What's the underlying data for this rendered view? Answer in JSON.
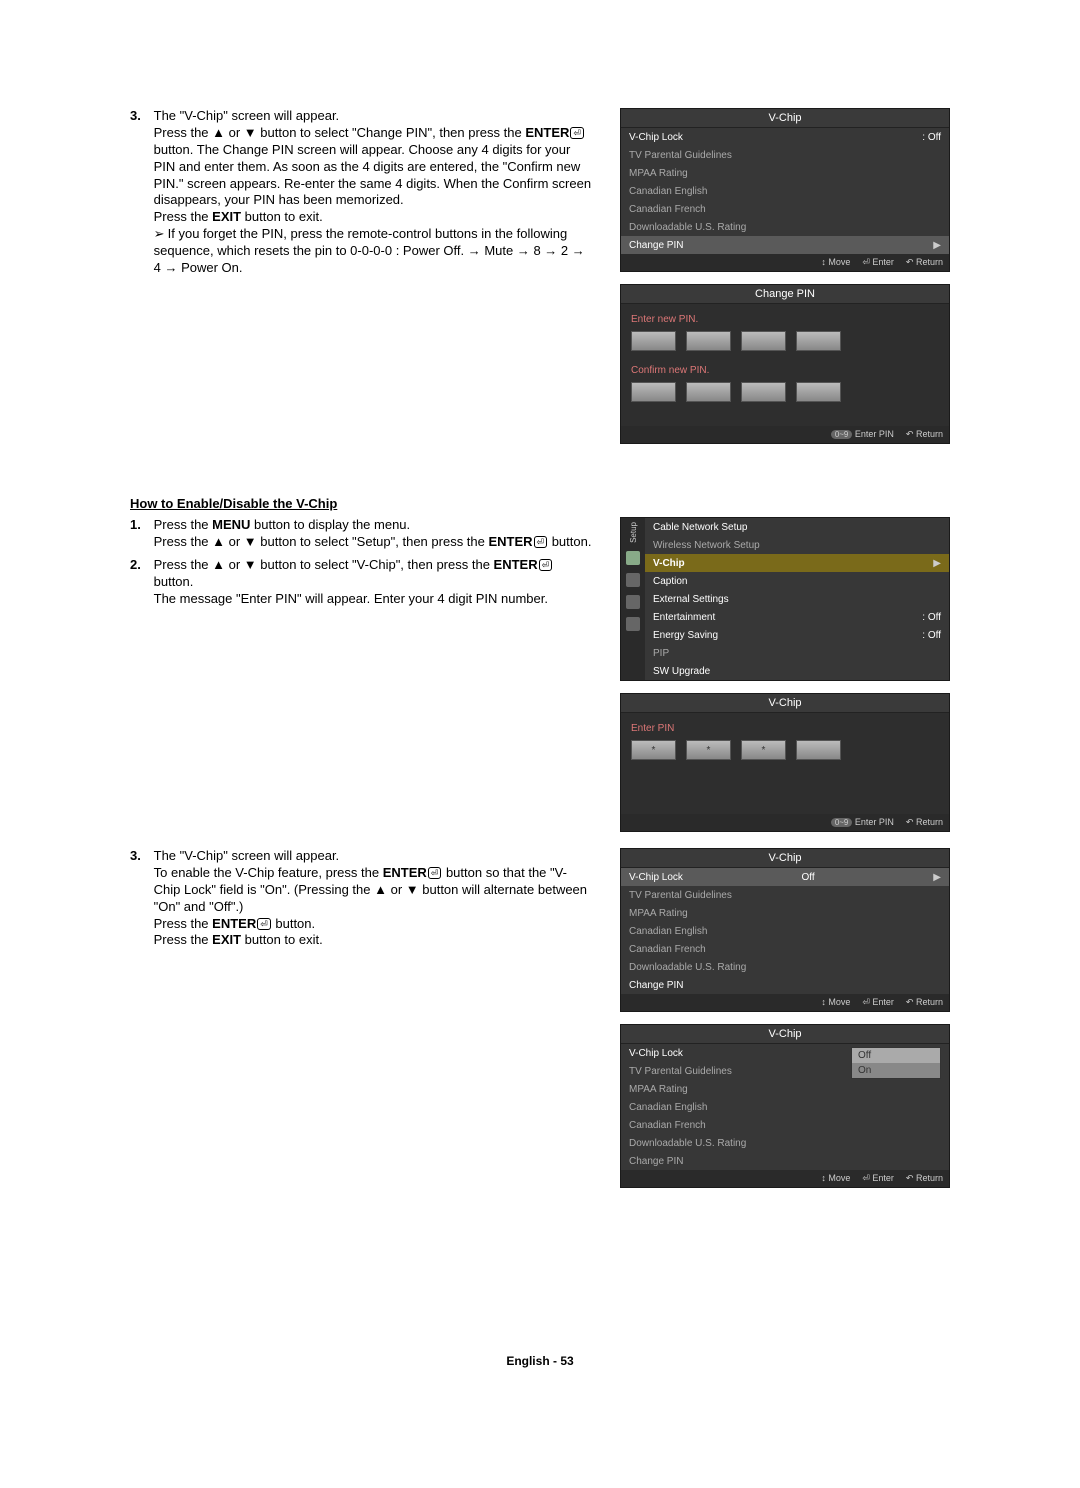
{
  "s1": {
    "num": "3.",
    "p1": "The \"V-Chip\" screen will appear.",
    "p2a": "Press the ▲ or ▼ button to select \"Change PIN\", then press the ",
    "p2b": "ENTER",
    "p2c": " button. The Change PIN screen will appear. Choose any 4 digits for your PIN and enter them. As soon as the 4 digits are entered, the \"Confirm new PIN.\" screen appears. Re-enter the same 4 digits. When the Confirm screen disappears, your PIN has been memorized.",
    "p3a": "Press the ",
    "p3b": "EXIT",
    "p3c": " button to exit.",
    "notemark": "➢",
    "note": "If you forget the PIN, press the remote-control buttons in the following sequence, which resets the pin to 0-0-0-0 : Power Off. → Mute → 8 → 2 → 4 → Power On."
  },
  "head2": "How to Enable/Disable the V-Chip",
  "s2a": {
    "num": "1.",
    "p1a": "Press the ",
    "p1b": "MENU",
    "p1c": " button to display the menu.",
    "p2a": "Press the ▲ or ▼ button to select \"Setup\", then press the ",
    "p2b": "ENTER",
    "p2c": " button."
  },
  "s2b": {
    "num": "2.",
    "p1a": "Press the ▲ or ▼ button to select \"V-Chip\", then press the ",
    "p1b": "ENTER",
    "p1c": " button.",
    "p2": "The message \"Enter PIN\" will appear. Enter your 4 digit PIN number."
  },
  "s3": {
    "num": "3.",
    "p1": "The \"V-Chip\" screen will appear.",
    "p2a": "To enable the V-Chip feature, press the ",
    "p2b": "ENTER",
    "p2c": " button so that the \"V-Chip Lock\" field is \"On\". (Pressing the ▲ or ▼ button will alternate between \"On\" and \"Off\".)",
    "p3a": "Press the ",
    "p3b": "ENTER",
    "p3c": " button.",
    "p4a": "Press the ",
    "p4b": "EXIT",
    "p4c": " button to exit."
  },
  "vchip_menu": {
    "title": "V-Chip",
    "lock": "V-Chip Lock",
    "off": ": Off",
    "tv": "TV Parental Guidelines",
    "mpaa": "MPAA Rating",
    "ce": "Canadian English",
    "cf": "Canadian French",
    "dl": "Downloadable U.S. Rating",
    "cp": "Change PIN"
  },
  "vchip_menu2_off": "Off",
  "foot": {
    "move": "Move",
    "enter": "Enter",
    "return": "Return",
    "updown": "↕",
    "enterpin": "Enter PIN",
    "pill": "0~9",
    "enticon": "⏎",
    "reticon": "↶"
  },
  "change_pin": {
    "title": "Change PIN",
    "enter": "Enter new PIN.",
    "confirm": "Confirm new PIN."
  },
  "setup_menu": {
    "side": "Setup",
    "cable": "Cable Network Setup",
    "wireless": "Wireless Network Setup",
    "vchip": "V-Chip",
    "caption": "Caption",
    "ext": "External Settings",
    "ent": "Entertainment",
    "entv": ": Off",
    "es": "Energy Saving",
    "esv": ": Off",
    "pip": "PIP",
    "sw": "SW Upgrade",
    "arrow": "▶"
  },
  "vchip_pin": {
    "title": "V-Chip",
    "enter": "Enter PIN",
    "star": "*"
  },
  "opt": {
    "off": "Off",
    "on": "On"
  },
  "footer": "English - 53"
}
